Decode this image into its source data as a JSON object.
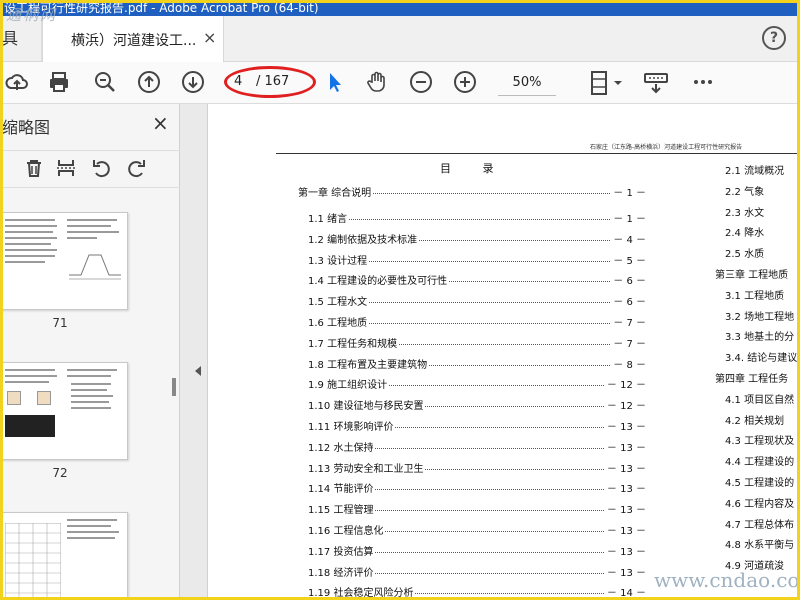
{
  "window": {
    "title": "设工程可行性研究报告.pdf - Adobe Acrobat Pro (64-bit)"
  },
  "watermark": {
    "top": "通柄网",
    "bottom": "www.cndao.com"
  },
  "tabs": {
    "tools_label": "具",
    "doc_label": "横浜）河道建设工...",
    "close_glyph": "×"
  },
  "help": {
    "glyph": "?"
  },
  "toolbar": {
    "page_current": "4",
    "page_total": "/ 167",
    "zoom": "50%",
    "icons": [
      "upload-icon",
      "print-icon",
      "zoom-search-icon",
      "page-up-icon",
      "page-down-icon",
      "select-cursor-icon",
      "hand-tool-icon",
      "zoom-out-icon",
      "zoom-in-icon",
      "fit-page-icon",
      "read-mode-icon",
      "more-icon"
    ]
  },
  "sidebar": {
    "title": "缩略图",
    "close_glyph": "×",
    "thumbnails": [
      {
        "label": "71"
      },
      {
        "label": "72"
      },
      {
        "label": ""
      }
    ]
  },
  "document": {
    "header": "石家庄（江东路-高桥横浜）河道建设工程可行性研究报告",
    "toc_title": "目 录",
    "toc_left": [
      {
        "label": "第一章  综合说明",
        "page": "－ 1 －",
        "chapter": true
      },
      {
        "label": "1.1  绪言",
        "page": "－ 1 －"
      },
      {
        "label": "1.2 编制依据及技术标准",
        "page": "－ 4 －"
      },
      {
        "label": "1.3  设计过程",
        "page": "－ 5 －"
      },
      {
        "label": "1.4 工程建设的必要性及可行性",
        "page": "－ 6 －"
      },
      {
        "label": "1.5  工程水文",
        "page": "－ 6 －"
      },
      {
        "label": "1.6  工程地质",
        "page": "－ 7 －"
      },
      {
        "label": "1.7  工程任务和规模",
        "page": "－ 7 －"
      },
      {
        "label": "1.8  工程布置及主要建筑物",
        "page": "－ 8 －"
      },
      {
        "label": "1.9 施工组织设计",
        "page": "－ 12 －"
      },
      {
        "label": "1.10  建设征地与移民安置",
        "page": "－ 12 －"
      },
      {
        "label": "1.11  环境影响评价",
        "page": "－ 13 －"
      },
      {
        "label": "1.12  水土保持",
        "page": "－ 13 －"
      },
      {
        "label": "1.13  劳动安全和工业卫生",
        "page": "－ 13 －"
      },
      {
        "label": "1.14  节能评价",
        "page": "－ 13 －"
      },
      {
        "label": "1.15  工程管理",
        "page": "－ 13 －"
      },
      {
        "label": "1.16  工程信息化",
        "page": "－ 13 －"
      },
      {
        "label": "1.17  投资估算",
        "page": "－ 13 －"
      },
      {
        "label": "1.18  经济评价",
        "page": "－ 13 －"
      },
      {
        "label": "1.19  社会稳定风险分析",
        "page": "－ 14 －"
      }
    ],
    "toc_right": [
      "2.1 流域概况",
      "2.2  气象",
      "2.3 水文",
      "2.4  降水",
      "2.5  水质",
      "第三章  工程地质",
      "3.1 工程地质",
      "3.2  场地工程地",
      "3.3 地基土的分",
      "3.4. 结论与建议",
      "第四章  工程任务",
      "4.1 项目区自然",
      "4.2  相关规划",
      "4.3  工程现状及",
      "4.4  工程建设的",
      "4.5  工程建设的",
      "4.6  工程内容及",
      "4.7  工程总体布",
      "4.8 水系平衡与",
      "4.9 河道疏浚"
    ]
  }
}
